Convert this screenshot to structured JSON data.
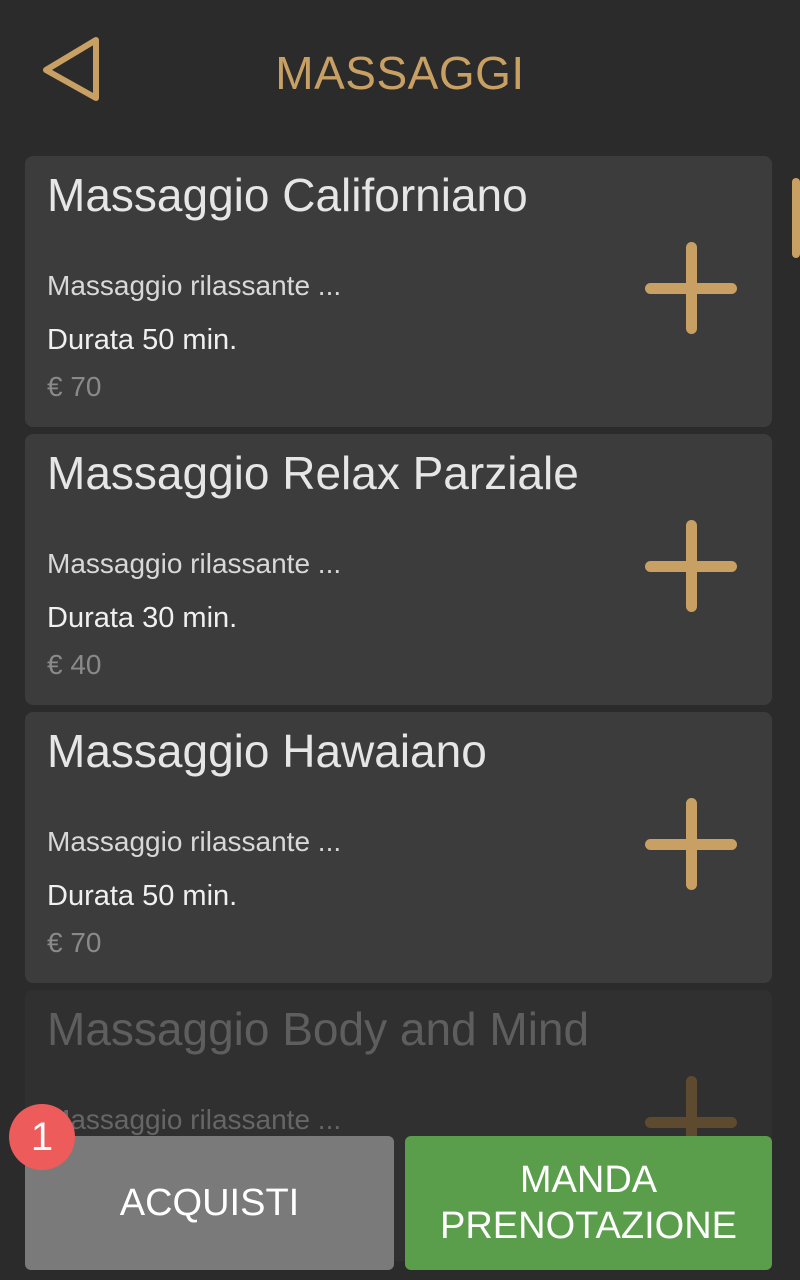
{
  "header": {
    "title": "MASSAGGI",
    "back_icon": "back-triangle-icon"
  },
  "colors": {
    "accent": "#c9a063",
    "background": "#2b2b2b",
    "card": "#3c3c3c",
    "send_button": "#5a9e4b",
    "cart_button": "#7a7a7a",
    "badge": "#ee5b5b"
  },
  "services": [
    {
      "title": "Massaggio Californiano",
      "description": "Massaggio rilassante ...",
      "duration": "Durata 50 min.",
      "price": "€ 70"
    },
    {
      "title": "Massaggio Relax Parziale",
      "description": "Massaggio rilassante ...",
      "duration": "Durata 30 min.",
      "price": "€ 40"
    },
    {
      "title": "Massaggio Hawaiano",
      "description": "Massaggio rilassante ...",
      "duration": "Durata 50 min.",
      "price": "€ 70"
    },
    {
      "title": "Massaggio Body and Mind",
      "description": "Massaggio rilassante ..."
    }
  ],
  "footer": {
    "cart_label": "ACQUISTI",
    "cart_count": "1",
    "send_line1": "MANDA",
    "send_line2": "PRENOTAZIONE"
  }
}
